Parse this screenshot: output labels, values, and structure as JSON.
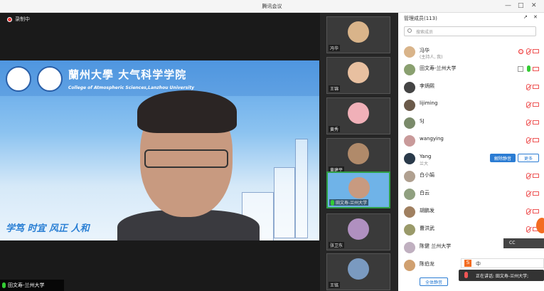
{
  "window": {
    "title": "腾讯会议"
  },
  "recording": {
    "label": "录制中"
  },
  "speaker": {
    "name": "田文寿-兰州大学"
  },
  "banner": {
    "university_name": "蘭州大學 大气科学学院",
    "university_subtitle": "College of Atmospheric Sciences,Lanzhou University",
    "motto": "学笃 时宜 风正 人和"
  },
  "thumbnails": [
    {
      "name": "冯华"
    },
    {
      "name": "王锦"
    },
    {
      "name": "黄秀"
    },
    {
      "name": "黄建平"
    },
    {
      "name": "田文寿-兰州大学"
    },
    {
      "name": "张卫东"
    },
    {
      "name": "王铭"
    }
  ],
  "panel": {
    "title": "管理成员(113)",
    "search_placeholder": "搜索成员",
    "mute_all": "全体静音",
    "unmute": "解除静音",
    "more": "更多"
  },
  "members": [
    {
      "name": "冯华",
      "sub": "(主持人, 我)",
      "avatar_color": "#d9b48a"
    },
    {
      "name": "田文寿-兰州大学",
      "sub": "",
      "avatar_color": "#8aa070"
    },
    {
      "name": "李炳熙",
      "sub": "",
      "avatar_color": "#444444"
    },
    {
      "name": "lijiming",
      "sub": "",
      "avatar_color": "#6b5a4a"
    },
    {
      "name": "SJ",
      "sub": "",
      "avatar_color": "#7a8a6a"
    },
    {
      "name": "wangying",
      "sub": "",
      "avatar_color": "#c99a9a"
    },
    {
      "name": "Yang",
      "sub": "兰大",
      "avatar_color": "#2a3a4a"
    },
    {
      "name": "白小娟",
      "sub": "",
      "avatar_color": "#b0a090"
    },
    {
      "name": "白云",
      "sub": "",
      "avatar_color": "#90a080"
    },
    {
      "name": "胡鹏发",
      "sub": "",
      "avatar_color": "#a08060"
    },
    {
      "name": "曹洪武",
      "sub": "",
      "avatar_color": "#9a9a6a"
    },
    {
      "name": "陈健 兰州大学",
      "sub": "",
      "avatar_color": "#c0b0c0"
    },
    {
      "name": "陈伯龙",
      "sub": "",
      "avatar_color": "#d0a070"
    }
  ],
  "ime": {
    "label": "中"
  },
  "cc": {
    "label": "CC"
  },
  "speaking_now": {
    "label": "正在讲话: 田文寿-兰州大学;"
  },
  "colors": {
    "accent": "#2b7cd3",
    "active_border": "#2f9e44",
    "alert": "#e55555"
  }
}
